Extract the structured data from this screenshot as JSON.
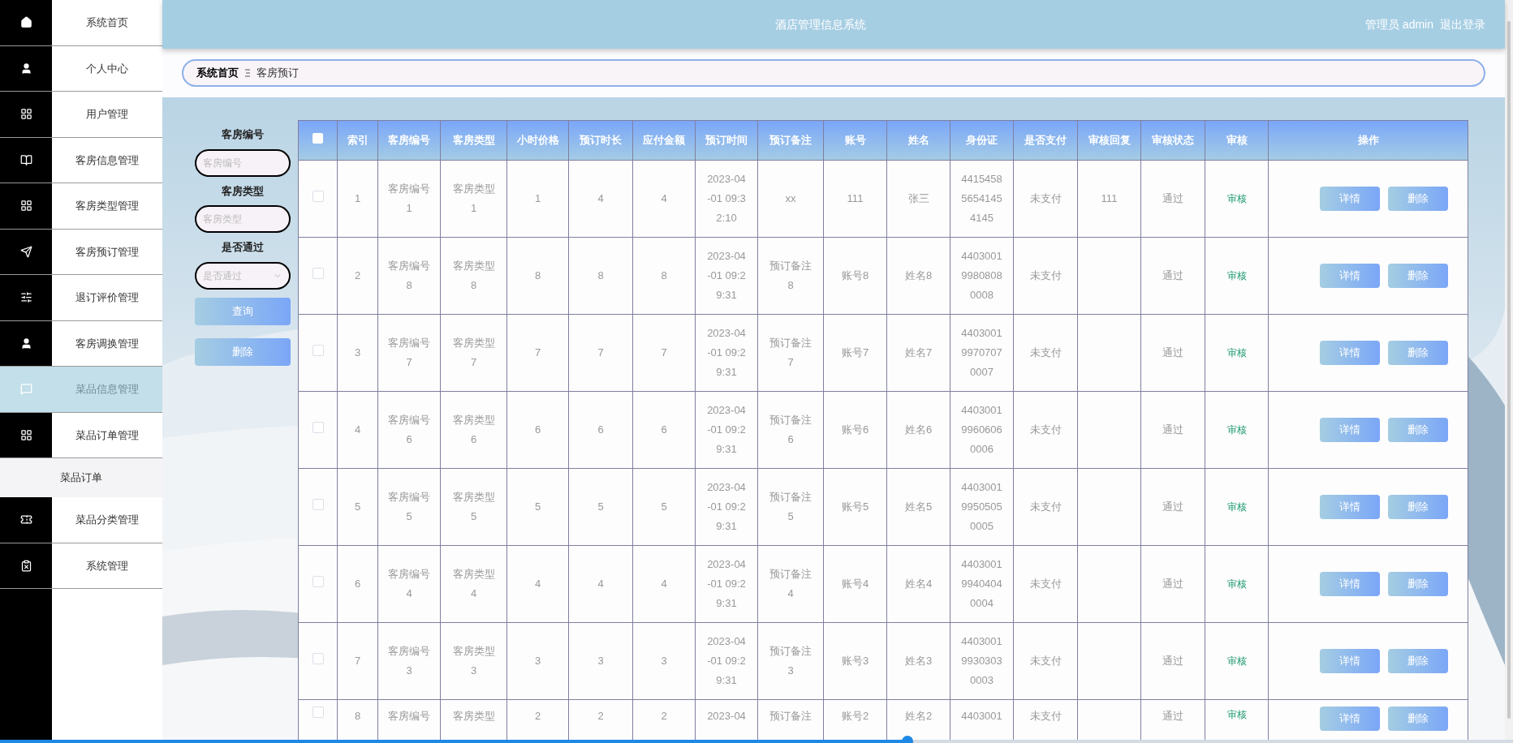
{
  "sidebar": {
    "items": [
      {
        "label": "系统首页",
        "selected": false
      },
      {
        "label": "个人中心",
        "selected": false
      },
      {
        "label": "用户管理",
        "selected": false
      },
      {
        "label": "客房信息管理",
        "selected": false
      },
      {
        "label": "客房类型管理",
        "selected": false
      },
      {
        "label": "客房预订管理",
        "selected": false
      },
      {
        "label": "退订评价管理",
        "selected": false
      },
      {
        "label": "客房调换管理",
        "selected": false
      },
      {
        "label": "菜品信息管理",
        "selected": true
      },
      {
        "label": "菜品订单管理",
        "selected": false,
        "children": [
          {
            "label": "菜品订单"
          }
        ]
      },
      {
        "label": "菜品分类管理",
        "selected": false
      },
      {
        "label": "系统管理",
        "selected": false
      }
    ]
  },
  "header": {
    "title": "酒店管理信息系统",
    "user": "管理员 admin",
    "logout": "退出登录"
  },
  "breadcrumb": [
    "系统首页",
    "客房预订"
  ],
  "filters": [
    {
      "label": "客房编号",
      "placeholder": "客房编号",
      "kind": "text"
    },
    {
      "label": "客房类型",
      "placeholder": "客房类型",
      "kind": "text"
    },
    {
      "label": "是否通过",
      "placeholder": "是否通过",
      "kind": "select"
    }
  ],
  "filter_buttons": [
    "查询",
    "删除"
  ],
  "table": {
    "all_checked": false,
    "columns": [
      {
        "kind": "check"
      },
      {
        "label": "索引",
        "kind": "text"
      },
      {
        "label": "客房编号",
        "kind": "text"
      },
      {
        "label": "客房类型",
        "kind": "text"
      },
      {
        "label": "小时价格",
        "kind": "text"
      },
      {
        "label": "预订时长",
        "kind": "text"
      },
      {
        "label": "应付金额",
        "kind": "text"
      },
      {
        "label": "预订时间",
        "kind": "text"
      },
      {
        "label": "预订备注",
        "kind": "text"
      },
      {
        "label": "账号",
        "kind": "text"
      },
      {
        "label": "姓名",
        "kind": "text"
      },
      {
        "label": "身份证",
        "kind": "text"
      },
      {
        "label": "是否支付",
        "kind": "text"
      },
      {
        "label": "审核回复",
        "kind": "text"
      },
      {
        "label": "审核状态",
        "kind": "text"
      },
      {
        "label": "审核",
        "kind": "link"
      },
      {
        "label": "操作",
        "kind": "actions"
      }
    ],
    "rows": [
      {
        "checked": false,
        "cells": [
          "",
          "1",
          "客房编号1",
          "客房类型1",
          "1",
          "4",
          "4",
          "2023-04-01 09:32:10",
          "xx",
          "111",
          "张三",
          "441545856541454145",
          "未支付",
          "111",
          "通过",
          "审核"
        ],
        "actions": [
          "详情",
          "删除"
        ]
      },
      {
        "checked": false,
        "cells": [
          "",
          "2",
          "客房编号8",
          "客房类型8",
          "8",
          "8",
          "8",
          "2023-04-01 09:29:31",
          "预订备注8",
          "账号8",
          "姓名8",
          "440300199808080008",
          "未支付",
          null,
          "通过",
          "审核"
        ],
        "actions": [
          "详情",
          "删除"
        ]
      },
      {
        "checked": false,
        "cells": [
          "",
          "3",
          "客房编号7",
          "客房类型7",
          "7",
          "7",
          "7",
          "2023-04-01 09:29:31",
          "预订备注7",
          "账号7",
          "姓名7",
          "440300199707070007",
          "未支付",
          null,
          "通过",
          "审核"
        ],
        "actions": [
          "详情",
          "删除"
        ]
      },
      {
        "checked": false,
        "cells": [
          "",
          "4",
          "客房编号6",
          "客房类型6",
          "6",
          "6",
          "6",
          "2023-04-01 09:29:31",
          "预订备注6",
          "账号6",
          "姓名6",
          "440300199606060006",
          "未支付",
          null,
          "通过",
          "审核"
        ],
        "actions": [
          "详情",
          "删除"
        ]
      },
      {
        "checked": false,
        "cells": [
          "",
          "5",
          "客房编号5",
          "客房类型5",
          "5",
          "5",
          "5",
          "2023-04-01 09:29:31",
          "预订备注5",
          "账号5",
          "姓名5",
          "440300199505050005",
          "未支付",
          null,
          "通过",
          "审核"
        ],
        "actions": [
          "详情",
          "删除"
        ]
      },
      {
        "checked": false,
        "cells": [
          "",
          "6",
          "客房编号4",
          "客房类型4",
          "4",
          "4",
          "4",
          "2023-04-01 09:29:31",
          "预订备注4",
          "账号4",
          "姓名4",
          "440300199404040004",
          "未支付",
          null,
          "通过",
          "审核"
        ],
        "actions": [
          "详情",
          "删除"
        ]
      },
      {
        "checked": false,
        "cells": [
          "",
          "7",
          "客房编号3",
          "客房类型3",
          "3",
          "3",
          "3",
          "2023-04-01 09:29:31",
          "预订备注3",
          "账号3",
          "姓名3",
          "440300199303030003",
          "未支付",
          null,
          "通过",
          "审核"
        ],
        "actions": [
          "详情",
          "删除"
        ]
      },
      {
        "checked": false,
        "cells": [
          "",
          "8",
          "客房编号",
          "客房类型",
          "2",
          "2",
          "2",
          "2023-04",
          "预订备注",
          "账号2",
          "姓名2",
          "4403001",
          "未支付",
          null,
          "通过",
          "审核"
        ],
        "actions": [
          "详情",
          "删除"
        ]
      }
    ]
  },
  "progress_bar": {
    "level": 0.6
  }
}
